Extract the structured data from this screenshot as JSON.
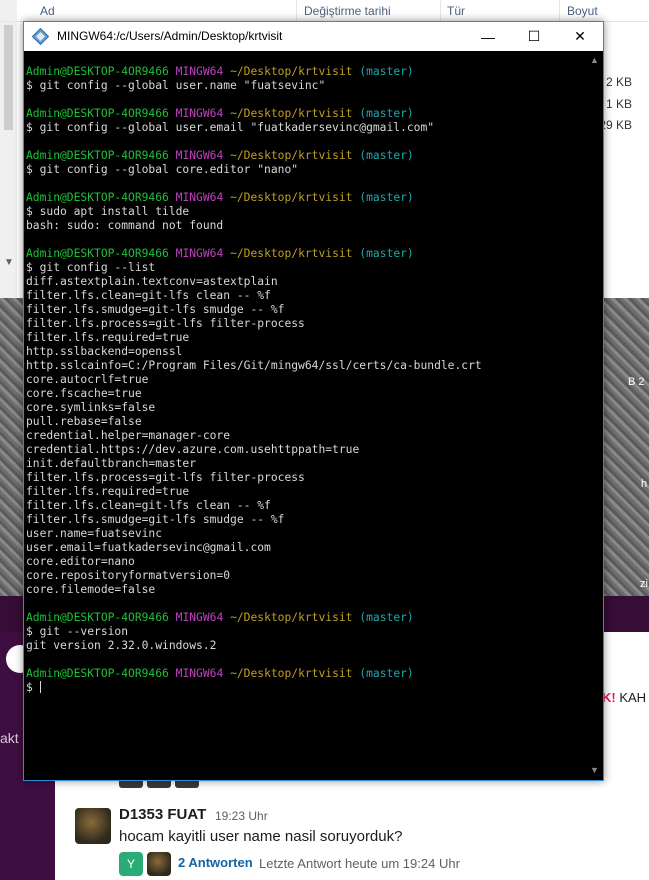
{
  "explorer": {
    "columns": [
      "Ad",
      "Değiştirme tarihi",
      "Tür",
      "Boyut"
    ],
    "sizes": [
      "2 KB",
      "1 KB",
      "29 KB"
    ]
  },
  "wallpaper": {
    "labels": [
      "B 2",
      "h",
      "zi"
    ]
  },
  "window": {
    "title": "MINGW64:/c/Users/Admin/Desktop/krtvisit",
    "minimize": "—",
    "maximize": "☐",
    "close": "✕"
  },
  "terminal": {
    "prompt_user": "Admin@DESKTOP-4OR9466",
    "prompt_shell": "MINGW64",
    "prompt_path": "~/Desktop/krtvisit",
    "prompt_branch": "(master)",
    "blocks": [
      {
        "cmd": "$ git config --global user.name \"fuatsevinc\"",
        "output": []
      },
      {
        "cmd": "$ git config --global user.email \"fuatkadersevinc@gmail.com\"",
        "output": []
      },
      {
        "cmd": "$ git config --global core.editor \"nano\"",
        "output": []
      },
      {
        "cmd": "$ sudo apt install tilde",
        "output": [
          "bash: sudo: command not found"
        ]
      },
      {
        "cmd": "$ git config --list",
        "output": [
          "diff.astextplain.textconv=astextplain",
          "filter.lfs.clean=git-lfs clean -- %f",
          "filter.lfs.smudge=git-lfs smudge -- %f",
          "filter.lfs.process=git-lfs filter-process",
          "filter.lfs.required=true",
          "http.sslbackend=openssl",
          "http.sslcainfo=C:/Program Files/Git/mingw64/ssl/certs/ca-bundle.crt",
          "core.autocrlf=true",
          "core.fscache=true",
          "core.symlinks=false",
          "pull.rebase=false",
          "credential.helper=manager-core",
          "credential.https://dev.azure.com.usehttppath=true",
          "init.defaultbranch=master",
          "filter.lfs.process=git-lfs filter-process",
          "filter.lfs.required=true",
          "filter.lfs.clean=git-lfs clean -- %f",
          "filter.lfs.smudge=git-lfs smudge -- %f",
          "user.name=fuatsevinc",
          "user.email=fuatkadersevinc@gmail.com",
          "core.editor=nano",
          "core.repositoryformatversion=0",
          "core.filemode=false"
        ]
      },
      {
        "cmd": "$ git --version",
        "output": [
          "git version 2.32.0.windows.2"
        ]
      }
    ],
    "final_prompt": "$ "
  },
  "slack": {
    "sidebar_label": "akt",
    "kah": "KAH",
    "kah_mark": "K!",
    "message": {
      "author": "D1353 FUAT",
      "time": "19:23 Uhr",
      "text": "hocam kayitli user name nasil soruyorduk?",
      "thread_badge": "Y",
      "replies": "2 Antworten",
      "last_reply": "Letzte Antwort heute um 19:24 Uhr"
    }
  }
}
